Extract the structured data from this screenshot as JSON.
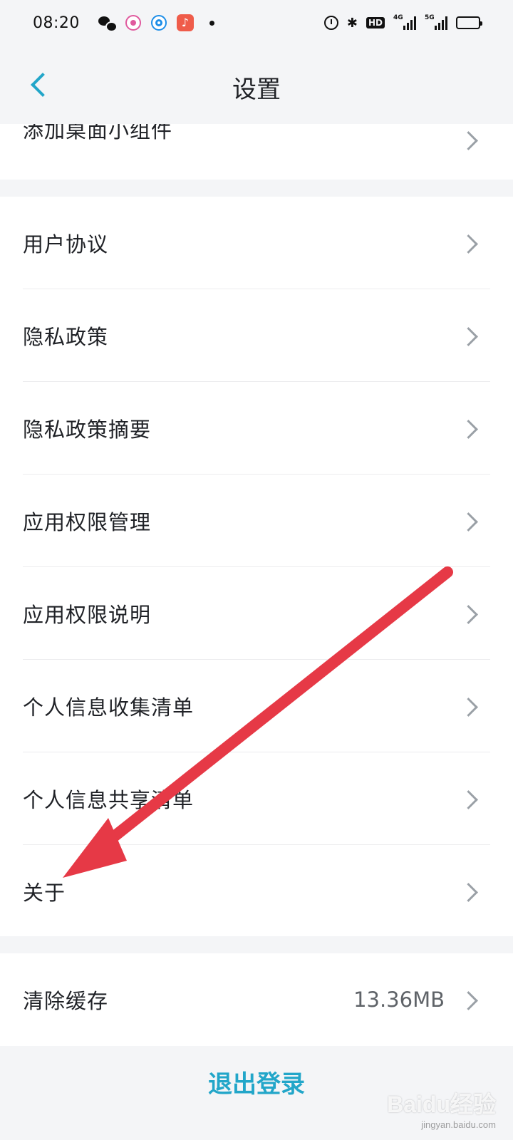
{
  "status_bar": {
    "time": "08:20",
    "left_icons": [
      "wechat-icon",
      "app-icon",
      "app-icon",
      "music-icon",
      "dot-icon"
    ],
    "right_icons": [
      "alarm-icon",
      "bluetooth-icon",
      "hd-icon",
      "signal-4g-icon",
      "signal-5g-icon",
      "battery-icon"
    ],
    "hd_label": "HD",
    "signal_4g_label": "4G",
    "signal_5g_label": "5G"
  },
  "header": {
    "title": "设置",
    "back_icon": "chevron-left-icon",
    "accent_color": "#22a6c9"
  },
  "groups": {
    "top": {
      "items": [
        {
          "label": "添加桌面小组件"
        }
      ]
    },
    "main": {
      "items": [
        {
          "label": "用户协议"
        },
        {
          "label": "隐私政策"
        },
        {
          "label": "隐私政策摘要"
        },
        {
          "label": "应用权限管理"
        },
        {
          "label": "应用权限说明"
        },
        {
          "label": "个人信息收集清单"
        },
        {
          "label": "个人信息共享清单"
        },
        {
          "label": "关于"
        }
      ]
    },
    "cache": {
      "label": "清除缓存",
      "value": "13.36MB"
    }
  },
  "logout": {
    "label": "退出登录"
  },
  "annotation": {
    "arrow_color": "#e63946",
    "points_to": "关于"
  },
  "watermark": {
    "logo": "Baidu经验",
    "sub": "jingyan.baidu.com"
  }
}
